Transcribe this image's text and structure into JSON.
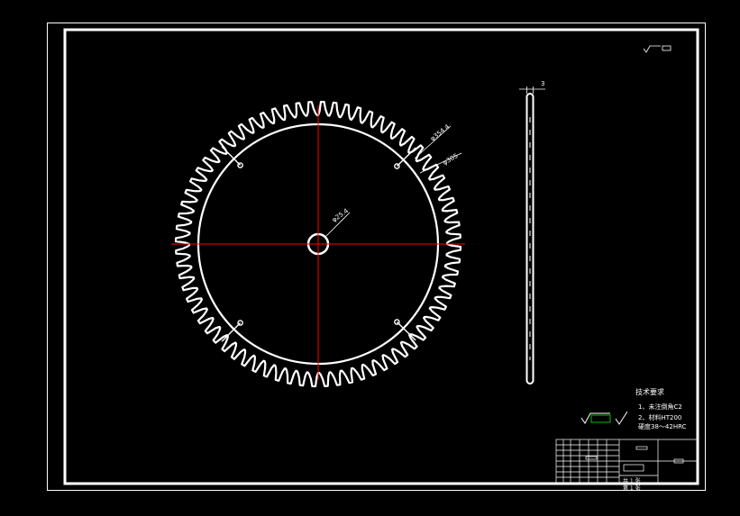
{
  "drawing": {
    "dims": {
      "outer_dia": "φ354.4",
      "inner_dia": "φ305",
      "bore_dia": "φ25.4",
      "thickness": "3"
    },
    "tech_req": {
      "title": "技术要求",
      "line1": "1、未注倒角C2",
      "line2": "2、材料HT200",
      "line3": "硬度38～42HRC"
    },
    "title_block": {
      "sheet_total": "共 1 张",
      "sheet_no": "第 1 张"
    },
    "colors": {
      "lines": "#ffffff",
      "centerline": "#ff0000",
      "roughness_frame": "#00c000"
    }
  }
}
